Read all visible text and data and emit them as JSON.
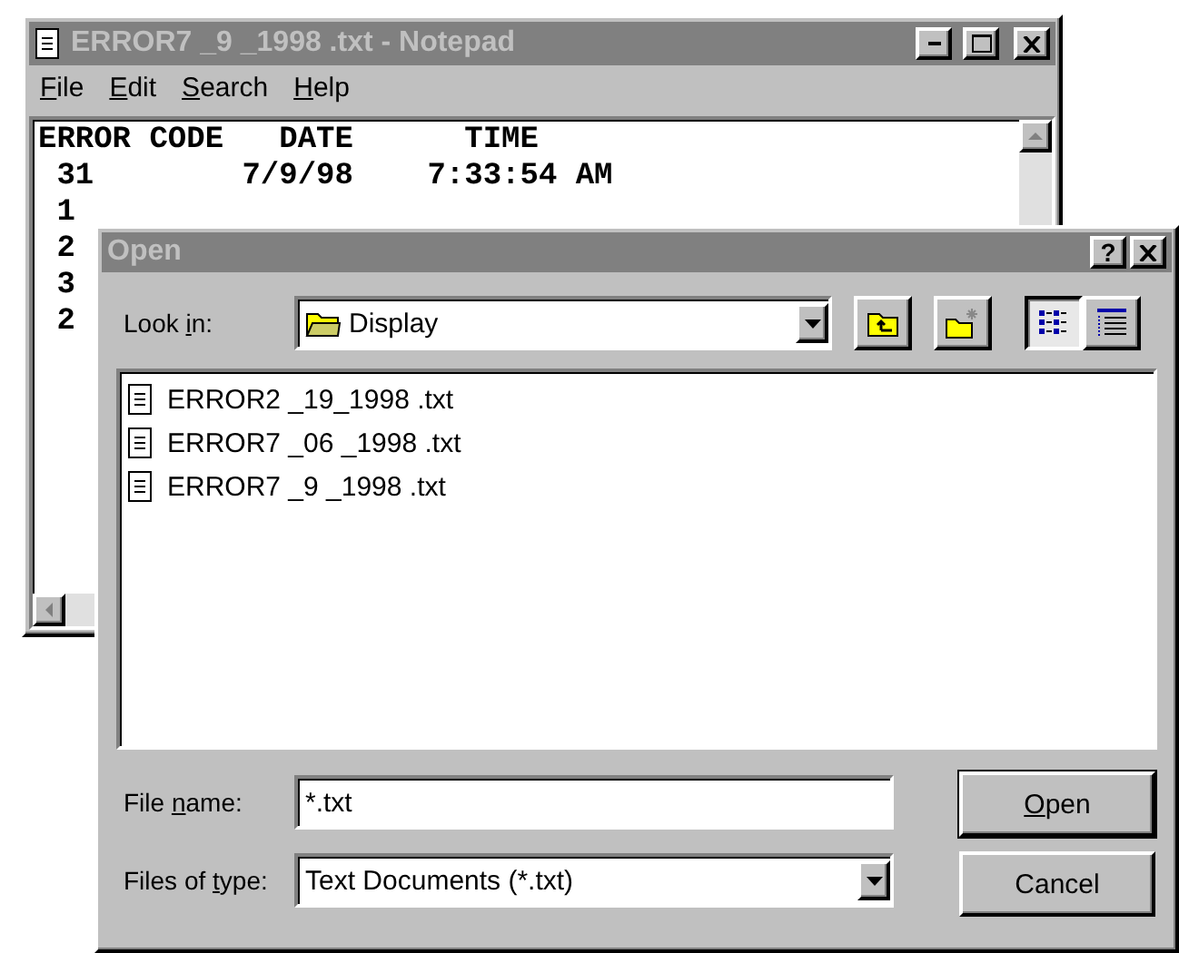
{
  "notepad": {
    "title": "ERROR7 _9 _1998 .txt - Notepad",
    "menu": [
      {
        "label": {
          "key": "F",
          "after": "ile"
        }
      },
      {
        "label": {
          "key": "E",
          "after": "dit"
        }
      },
      {
        "label": {
          "key": "S",
          "after": "earch"
        }
      },
      {
        "label": {
          "key": "H",
          "after": "elp"
        }
      }
    ],
    "lines": [
      "ERROR CODE   DATE      TIME",
      " 31        7/9/98    7:33:54 AM",
      " 1",
      " 2",
      " 3",
      " 2"
    ]
  },
  "dialog": {
    "title": "Open",
    "help_button": "?",
    "look_in": {
      "label": {
        "before": "Look ",
        "key": "i",
        "after": "n:"
      },
      "value": "Display"
    },
    "views": [
      {
        "kind": "list",
        "selected": true
      },
      {
        "kind": "details",
        "selected": false
      }
    ],
    "files": [
      {
        "name": "ERROR2 _19_1998 .txt",
        "selected": false
      },
      {
        "name": "ERROR7 _06 _1998 .txt",
        "selected": false
      },
      {
        "name": "ERROR7 _9 _1998 .txt",
        "selected": false
      }
    ],
    "file_name": {
      "label": {
        "before": "File ",
        "key": "n",
        "after": "ame:"
      },
      "value": "*.txt"
    },
    "file_type": {
      "label": {
        "before": "Files of ",
        "key": "t",
        "after": "ype:"
      },
      "value": "Text Documents (*.txt)"
    },
    "buttons": [
      {
        "kind": "default",
        "label": {
          "key": "O",
          "after": "pen"
        }
      },
      {
        "kind": "normal",
        "label": {
          "before": "Cancel"
        }
      }
    ]
  }
}
